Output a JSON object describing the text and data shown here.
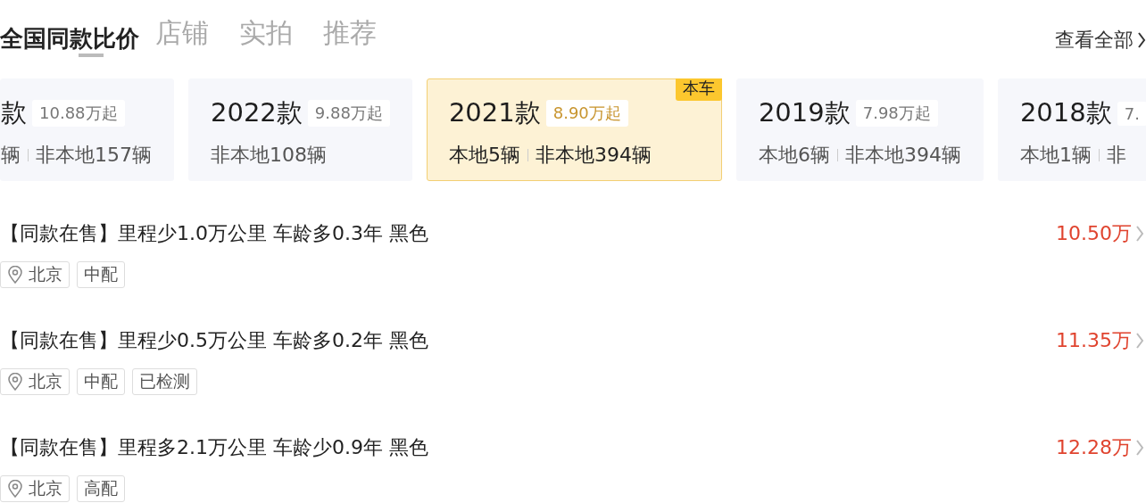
{
  "tabs": [
    {
      "label": "店铺",
      "selected": false
    },
    {
      "label": "实拍",
      "selected": false
    },
    {
      "label": "推荐",
      "selected": false
    }
  ],
  "section": {
    "title": "全国同款比价",
    "link": "查看全部"
  },
  "years": [
    {
      "year": "款",
      "price": "10.88万起",
      "stats": [
        "辆",
        "非本地157辆"
      ],
      "selected": false,
      "cut": true
    },
    {
      "year": "2022款",
      "price": "9.88万起",
      "stats": [
        "非本地108辆"
      ],
      "selected": false
    },
    {
      "year": "2021款",
      "price": "8.90万起",
      "stats": [
        "本地5辆",
        "非本地394辆"
      ],
      "selected": true,
      "badge": "本车"
    },
    {
      "year": "2019款",
      "price": "7.98万起",
      "stats": [
        "本地6辆",
        "非本地394辆"
      ],
      "selected": false
    },
    {
      "year": "2018款",
      "price": "7.",
      "stats": [
        "本地1辆",
        "非"
      ],
      "selected": false
    }
  ],
  "listings": [
    {
      "title": "【同款在售】里程少1.0万公里 车龄多0.3年 黑色",
      "price": "10.50万",
      "location": "北京",
      "tags": [
        "中配"
      ]
    },
    {
      "title": "【同款在售】里程少0.5万公里 车龄多0.2年 黑色",
      "price": "11.35万",
      "location": "北京",
      "tags": [
        "中配",
        "已检测"
      ]
    },
    {
      "title": "【同款在售】里程多2.1万公里 车龄少0.9年 黑色",
      "price": "12.28万",
      "location": "北京",
      "tags": [
        "高配"
      ]
    }
  ]
}
